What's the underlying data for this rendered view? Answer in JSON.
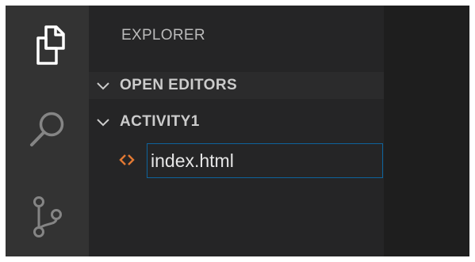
{
  "activity_bar": {
    "items": [
      {
        "icon": "files-icon"
      },
      {
        "icon": "search-icon"
      },
      {
        "icon": "source-control-icon"
      }
    ]
  },
  "sidebar": {
    "title": "EXPLORER",
    "sections": [
      {
        "label": "OPEN EDITORS",
        "expanded": true
      },
      {
        "label": "ACTIVITY1",
        "expanded": true
      }
    ],
    "files": [
      {
        "icon": "html-file-icon",
        "name": "index.html",
        "icon_color": "#e37933"
      }
    ]
  },
  "colors": {
    "activity_bar": "#333333",
    "sidebar": "#252526",
    "editor": "#1e1e1e",
    "focus_border": "#0e639c"
  }
}
